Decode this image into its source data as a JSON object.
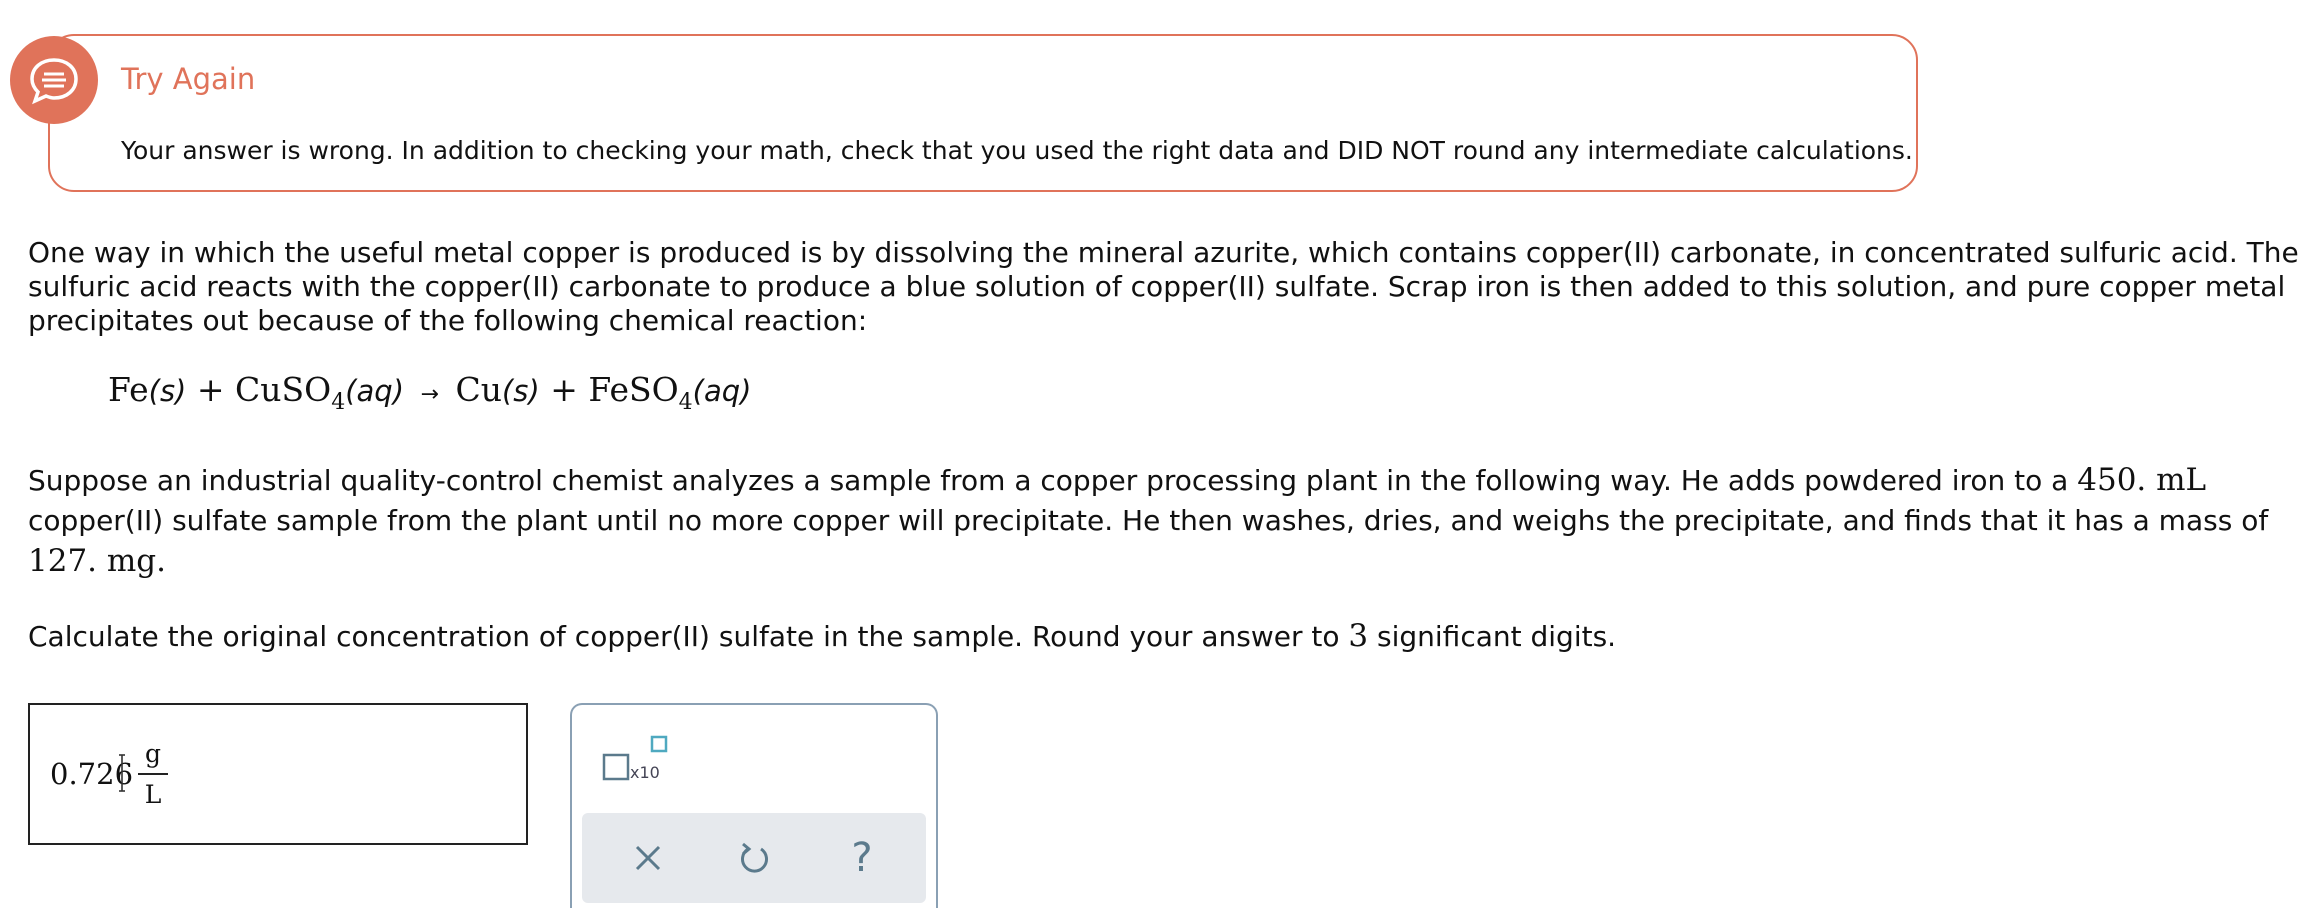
{
  "feedback": {
    "title": "Try Again",
    "message": "Your answer is wrong. In addition to checking your math, check that you used the right data and DID NOT round any intermediate calculations.",
    "icon": "speech-bubble-icon",
    "accent_color": "#e0735a"
  },
  "problem": {
    "intro": "One way in which the useful metal copper is produced is by dissolving the mineral azurite, which contains copper(II) carbonate, in concentrated sulfuric acid. The sulfuric acid reacts with the copper(II) carbonate to produce a blue solution of copper(II) sulfate. Scrap iron is then added to this solution, and pure copper metal precipitates out because of the following chemical reaction:",
    "equation": {
      "fe": "Fe",
      "fe_state": "(s)",
      "plus1": "+",
      "cuso_base": "CuSO",
      "cuso_sub": "4",
      "cuso_state": "(aq)",
      "arrow": "→",
      "cu": "Cu",
      "cu_state": "(s)",
      "plus2": "+",
      "feso_base": "FeSO",
      "feso_sub": "4",
      "feso_state": "(aq)"
    },
    "setup_part1": "Suppose an industrial quality-control chemist analyzes a sample from a copper processing plant in the following way. He adds powdered iron to a ",
    "volume": "450. mL",
    "setup_part2": " copper(II) sulfate sample from the plant until no more copper will precipitate. He then washes, dries, and weighs the precipitate, and finds that it has a mass of ",
    "mass": "127. mg",
    "setup_part3": ".",
    "question_part1": "Calculate the original concentration of copper(II) sulfate in the sample. Round your answer to ",
    "sig_digits": "3",
    "question_part2": " significant digits."
  },
  "answer": {
    "value": "0.726",
    "unit_numerator": "g",
    "unit_denominator": "L"
  },
  "tools": {
    "sci_notation_label": "x10",
    "clear_icon": "x-icon",
    "undo_icon": "undo-icon",
    "help_label": "?",
    "button_color": "#5b7a8c",
    "box_color": "#4fa9c0"
  }
}
